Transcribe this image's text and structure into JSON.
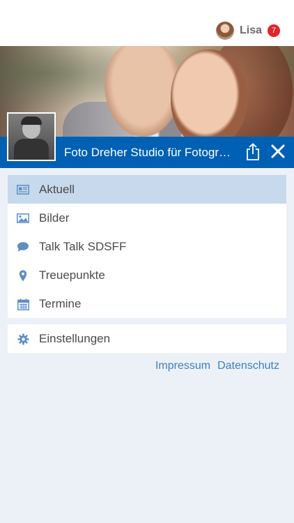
{
  "header": {
    "user_name": "Lisa",
    "notification_count": "7"
  },
  "studio": {
    "title": "Foto Dreher Studio für Fotogr…"
  },
  "menu": {
    "items": [
      {
        "label": "Aktuell",
        "icon": "newspaper-icon",
        "active": true
      },
      {
        "label": "Bilder",
        "icon": "image-icon",
        "active": false
      },
      {
        "label": "Talk Talk SDSFF",
        "icon": "chat-bubble-icon",
        "active": false
      },
      {
        "label": "Treuepunkte",
        "icon": "location-pin-icon",
        "active": false
      },
      {
        "label": "Termine",
        "icon": "calendar-icon",
        "active": false
      }
    ],
    "settings_label": "Einstellungen"
  },
  "footer": {
    "impressum": "Impressum",
    "datenschutz": "Datenschutz"
  },
  "colors": {
    "accent": "#0060b4",
    "active_row": "#c7d9ec",
    "icon": "#5b8fc4",
    "badge": "#e2232a",
    "background": "#ecf1f8"
  }
}
